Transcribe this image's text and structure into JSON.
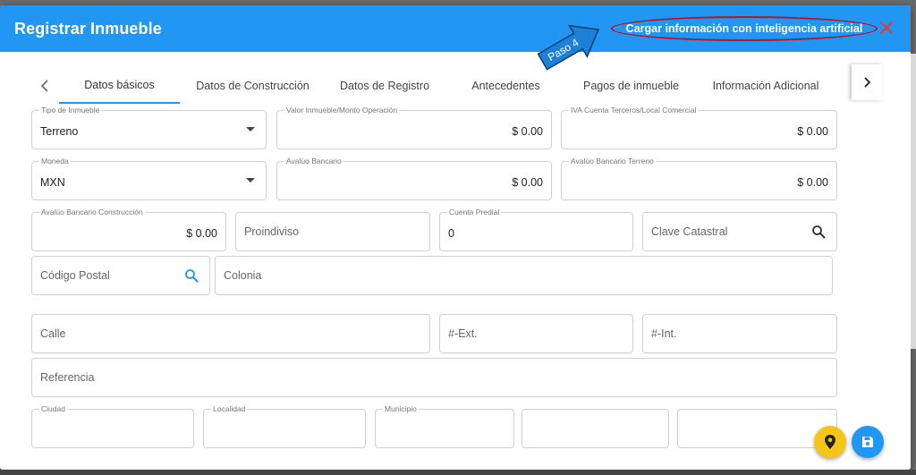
{
  "header": {
    "title": "Registrar Inmueble",
    "ai_link": "Cargar información con inteligencia artificial",
    "annotation": "Paso 4"
  },
  "tabs": [
    {
      "label": "Datos básicos",
      "active": true
    },
    {
      "label": "Datos de Construcción",
      "active": false
    },
    {
      "label": "Datos de Registro",
      "active": false
    },
    {
      "label": "Antecedentes",
      "active": false
    },
    {
      "label": "Pagos de inmueble",
      "active": false
    },
    {
      "label": "Información Adicional",
      "active": false
    }
  ],
  "form": {
    "tipo_inmueble": {
      "label": "Tipo de Inmueble",
      "value": "Terreno"
    },
    "valor_inmueble": {
      "label": "Valor Inmueble/Monto Operación",
      "value": "$ 0.00"
    },
    "iva_cuenta": {
      "label": "IVA Cuenta Terceros/Local Comercial",
      "value": "$ 0.00"
    },
    "moneda": {
      "label": "Moneda",
      "value": "MXN"
    },
    "avaluo_bancario": {
      "label": "Avalúo Bancario",
      "value": "$ 0.00"
    },
    "avaluo_terreno": {
      "label": "Avalúo Bancario Terreno",
      "value": "$ 0.00"
    },
    "avaluo_construccion": {
      "label": "Avalúo Bancario Construcción",
      "value": "$ 0.00"
    },
    "proindiviso": {
      "placeholder": "Proindiviso"
    },
    "cuenta_predial": {
      "label": "Cuenta Predial",
      "value": "0"
    },
    "clave_catastral": {
      "placeholder": "Clave Catastral"
    },
    "codigo_postal": {
      "placeholder": "Código Postal"
    },
    "colonia": {
      "placeholder": "Colonia"
    },
    "calle": {
      "placeholder": "Calle"
    },
    "num_ext": {
      "placeholder": "#-Ext."
    },
    "num_int": {
      "placeholder": "#-Int."
    },
    "referencia": {
      "placeholder": "Referencia"
    },
    "ciudad": {
      "label": "Ciudad"
    },
    "localidad": {
      "label": "Localidad"
    },
    "municipio": {
      "label": "Municipio"
    }
  },
  "colors": {
    "primary": "#2196f3",
    "annotation_red": "#b3162a",
    "annotation_blue": "#1e7fd6",
    "fab_location": "#f5c518",
    "fab_save": "#2196f3"
  },
  "icons": {
    "close": "close-icon",
    "search": "search-icon",
    "location": "location-pin-icon",
    "save": "save-icon"
  }
}
